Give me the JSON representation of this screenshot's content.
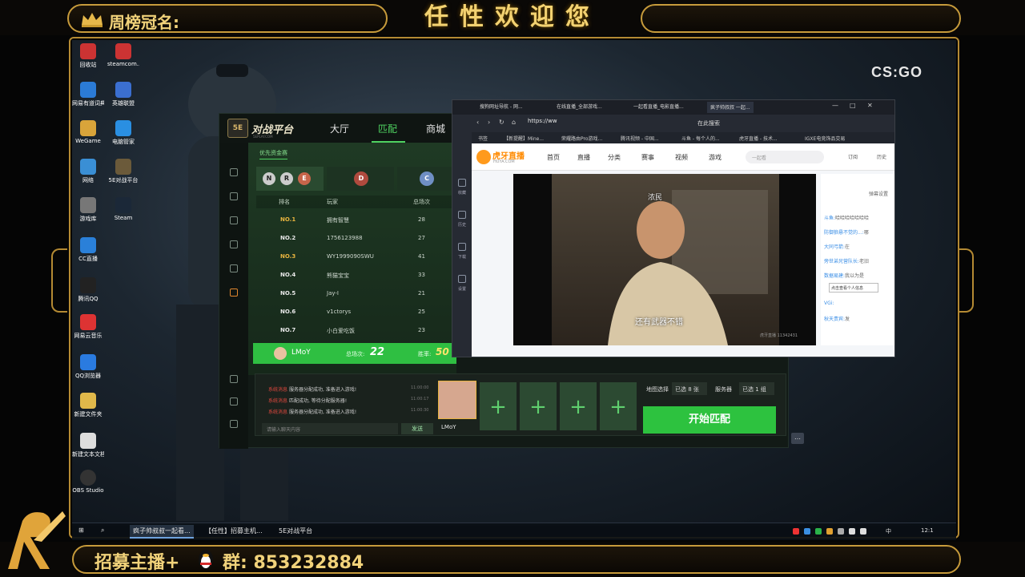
{
  "overlay": {
    "top_left_title": "周榜冠名:",
    "top_center_title": "任性欢迎您",
    "csgo_logo": "CS:GO",
    "recruit_text": "招募主播+",
    "group_text": "群: 853232884",
    "rk_logo": "RK",
    "accent_color": "#c79b3b"
  },
  "desktop": {
    "icons": [
      {
        "label": "回收站",
        "color": "#c33"
      },
      {
        "label": "steamcom...",
        "color": "#c33"
      },
      {
        "label": "网易有道词典",
        "color": "#2b7bd6"
      },
      {
        "label": "英雄联盟",
        "color": "#3b6fd0"
      },
      {
        "label": "WeGame",
        "color": "#d9a43a"
      },
      {
        "label": "电脑管家",
        "color": "#2a8fe2"
      },
      {
        "label": "网络",
        "color": "#3a8fd5"
      },
      {
        "label": "5E对战平台",
        "color": "#6b5a3a"
      },
      {
        "label": "游戏库",
        "color": "#777"
      },
      {
        "label": "Steam",
        "color": "#1b2838"
      },
      {
        "label": "CC直播",
        "color": "#2a80d9"
      },
      {
        "label": "腾讯QQ",
        "color": "#222"
      },
      {
        "label": "网易云音乐",
        "color": "#d33"
      },
      {
        "label": "QQ浏览器",
        "color": "#2a7be0"
      },
      {
        "label": "新建文件夹",
        "color": "#e0b84a"
      },
      {
        "label": "新建文本文档.txt",
        "color": "#ddd"
      },
      {
        "label": "OBS Studio",
        "color": "#333"
      }
    ]
  },
  "taskbar": {
    "items": [
      "疯子帅叔叔一起看...",
      "【任性】招募主机...",
      "5E对战平台"
    ],
    "tray": {
      "lang": "中",
      "time": "12:1"
    }
  },
  "platform": {
    "name": "对战平台",
    "subname": "5EPLAY.COM",
    "nav": [
      "大厅",
      "匹配",
      "商城"
    ],
    "active_nav": "匹配",
    "sub_tab": "优先资金赛",
    "badges": [
      "N",
      "R",
      "E"
    ],
    "headers": {
      "rank": "排名",
      "player": "玩家",
      "score": "总场次"
    },
    "rows": [
      {
        "rank": "NO.1",
        "player": "拥有智慧",
        "score": "28"
      },
      {
        "rank": "NO.2",
        "player": "1756123988",
        "score": "27"
      },
      {
        "rank": "NO.3",
        "player": "WY1999090SWU",
        "score": "41"
      },
      {
        "rank": "NO.4",
        "player": "熊猫宝宝",
        "score": "33"
      },
      {
        "rank": "NO.5",
        "player": "Jay-I",
        "score": "21"
      },
      {
        "rank": "NO.6",
        "player": "v1ctorys",
        "score": "25"
      },
      {
        "rank": "NO.7",
        "player": "小白爱吃饭",
        "score": "23"
      }
    ],
    "me": {
      "name": "LMoY",
      "total_label": "总场次:",
      "total": "22",
      "winrate_label": "胜率:",
      "winrate": "50"
    },
    "logs": [
      {
        "tag": "系统消息",
        "text": "服务器分配成功, 准备进入游戏!",
        "time": "11:00:00"
      },
      {
        "tag": "系统消息",
        "text": "匹配成功, 等待分配服务器!",
        "time": "11:00:17"
      },
      {
        "tag": "系统消息",
        "text": "服务器分配成功, 准备进入游戏!",
        "time": "11:00:30"
      }
    ],
    "chat_placeholder": "请输入聊天内容",
    "send_label": "发送",
    "my_slot_name": "LMoY",
    "map_select_label": "地图选择",
    "map_select_value": "已选 8 张",
    "server_label": "服务器",
    "server_value": "已选 1 组",
    "start_label": "开始匹配",
    "accent_color": "#2dc23f"
  },
  "browser": {
    "tabs": [
      "搜狗网址导航 - 网...",
      "在线直播_全部游戏...",
      "一起看直播_电影直播...",
      "疯子帅叔叔 一起..."
    ],
    "url": "https://ww",
    "search_label": "在此搜索",
    "bookmarks": [
      "书签",
      "【新提醒】Mine...",
      "荣耀路由Pro游戏...",
      "腾讯视频 - 中国...",
      "斗鱼 - 每个人的...",
      "虎牙直播 - 技术...",
      "IGXE电竞饰品交易"
    ],
    "side_labels": [
      "收藏",
      "历史",
      "下载",
      "设置"
    ],
    "site": {
      "name": "虎牙直播",
      "domain": "HUYA.COM",
      "nav": [
        "首页",
        "直播",
        "分类",
        "赛事",
        "视频",
        "游戏"
      ],
      "search_placeholder": "一起看",
      "subscribe": "订阅",
      "history": "历史"
    },
    "video": {
      "top_caption": "浓民",
      "subtitle": "还有武器不错",
      "room_id": "虎牙直播 11342431"
    },
    "chat": [
      {
        "name": "",
        "text": "弹幕设置"
      },
      {
        "name": "斗鱼:",
        "text": "哈哈哈哈哈哈哈"
      },
      {
        "name": "防御狼悬不觉的...:",
        "text": "哪"
      },
      {
        "name": "大同弓箭:",
        "text": "在"
      },
      {
        "name": "旁世弟兄营队长:",
        "text": "老旧"
      },
      {
        "name": "数据易建:",
        "text": "我以为是"
      },
      {
        "name": "VGi:",
        "text": ""
      },
      {
        "name": "秋天贵宾:",
        "text": "发"
      }
    ],
    "chat_tooltip": "点击查看个人信息"
  }
}
